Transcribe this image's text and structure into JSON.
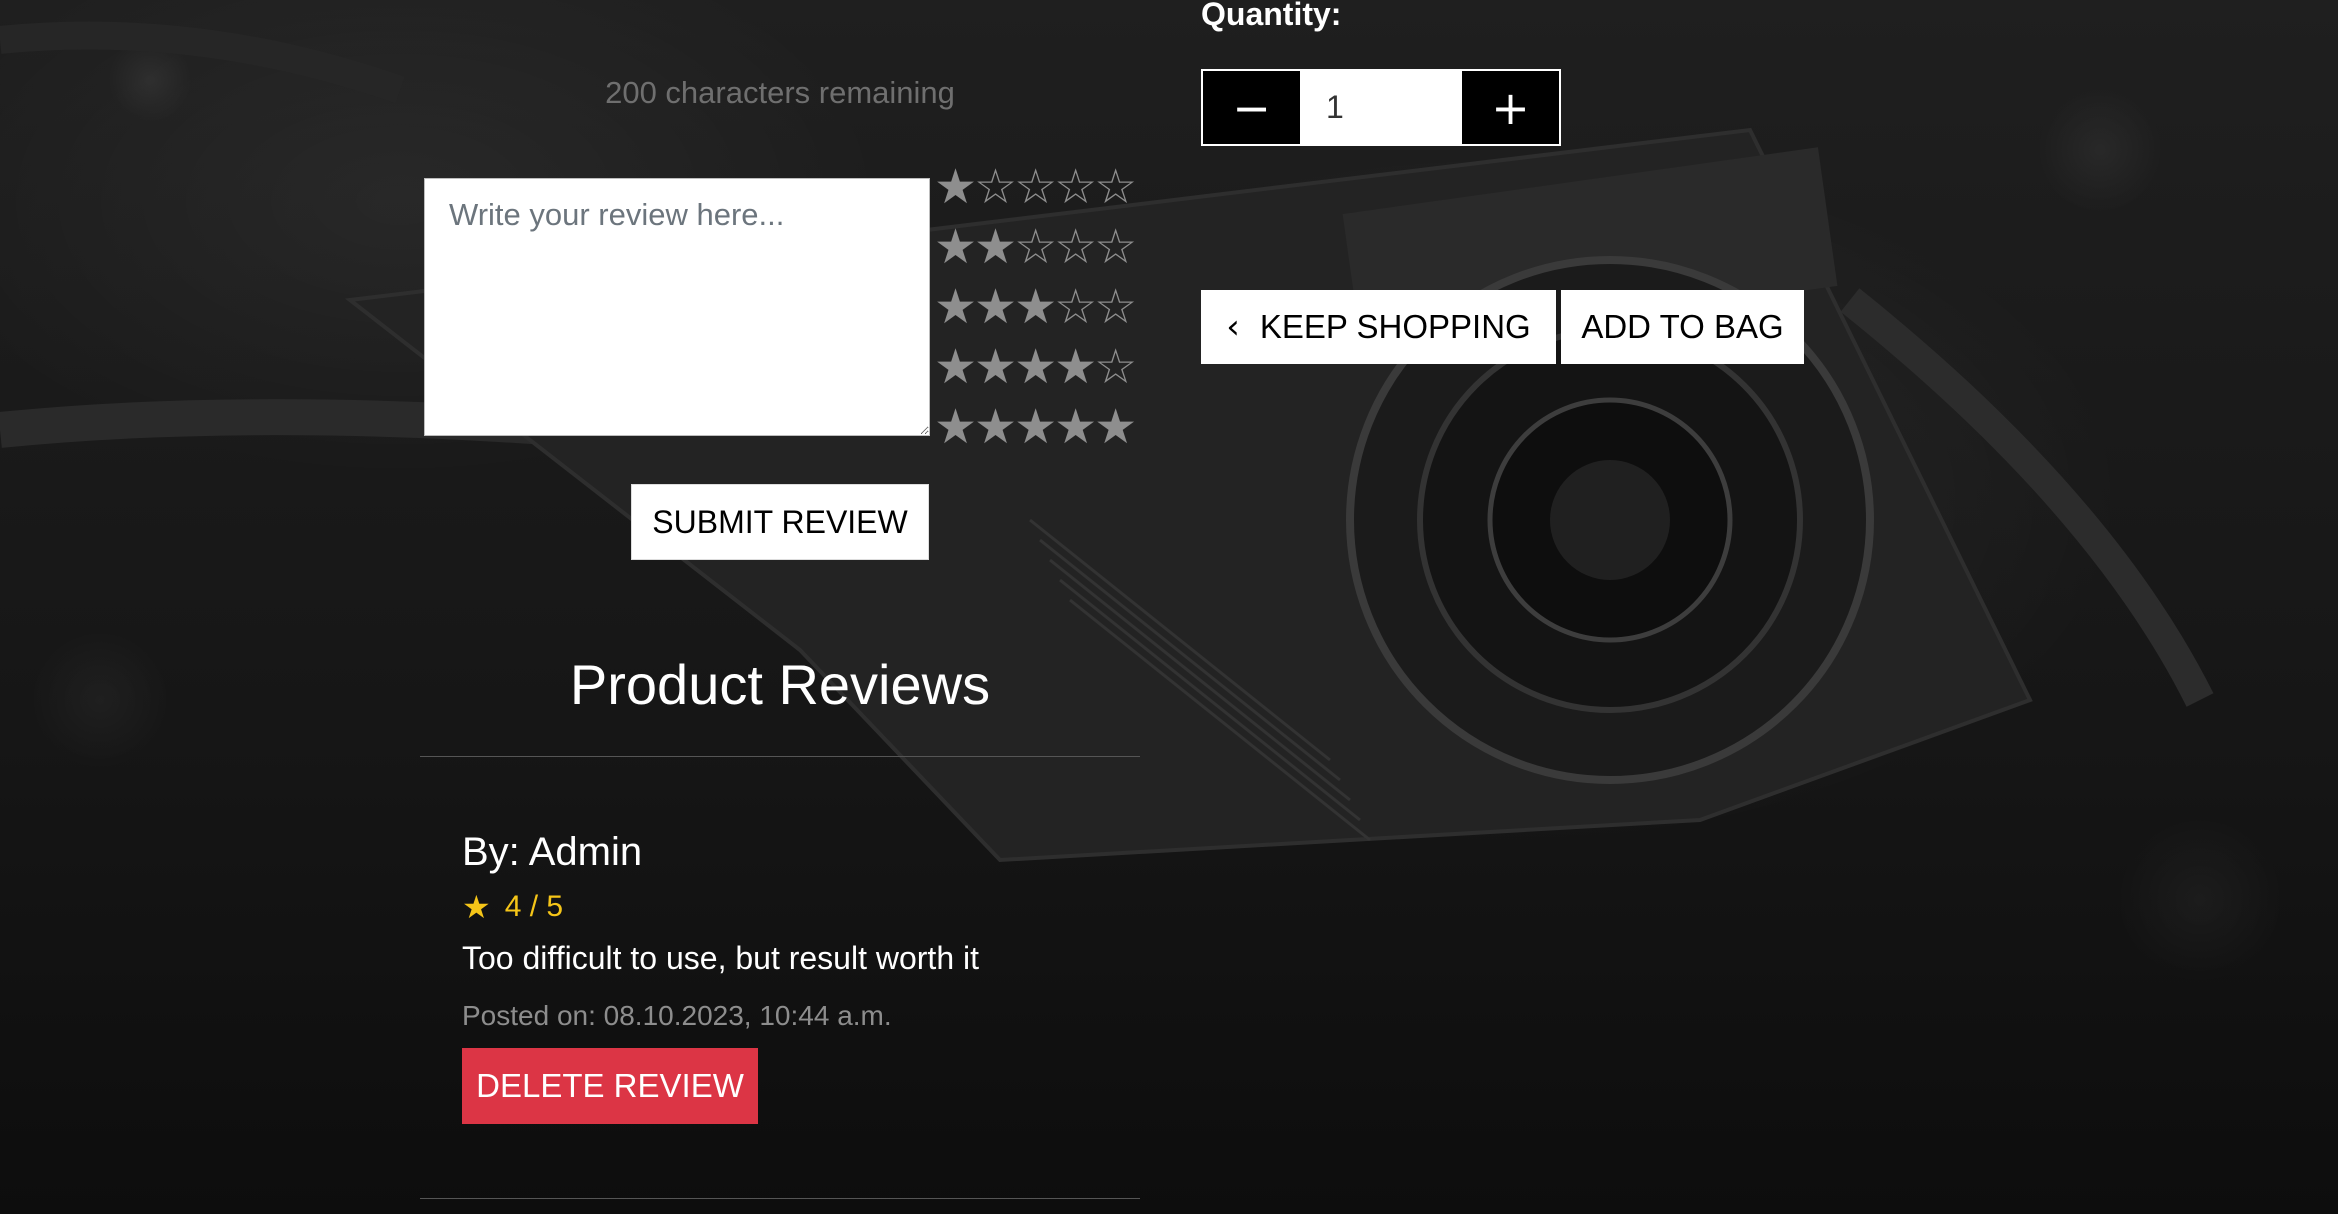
{
  "review_form": {
    "chars_remaining": "200 characters remaining",
    "textarea_placeholder": "Write your review here...",
    "rating_options": [
      {
        "filled": "★",
        "empty": "☆☆☆☆"
      },
      {
        "filled": "★★",
        "empty": "☆☆☆"
      },
      {
        "filled": "★★★",
        "empty": "☆☆"
      },
      {
        "filled": "★★★★",
        "empty": "☆"
      },
      {
        "filled": "★★★★★",
        "empty": ""
      }
    ],
    "submit_label": "SUBMIT REVIEW"
  },
  "reviews": {
    "heading": "Product Reviews",
    "items": [
      {
        "author": "By: Admin",
        "rating": "4 / 5",
        "body": "Too difficult to use, but result worth it",
        "posted": "Posted on: 08.10.2023, 10:44 a.m.",
        "delete_label": "DELETE REVIEW"
      }
    ]
  },
  "purchase": {
    "quantity_label": "Quantity:",
    "quantity_value": "1",
    "decrement_symbol": "−",
    "increment_symbol": "+",
    "keep_shopping_label": "KEEP SHOPPING",
    "add_to_bag_label": "ADD TO BAG"
  },
  "colors": {
    "delete_button": "#dc3545",
    "rating_star": "#f5c518"
  },
  "icons": {
    "rating": "star-icon",
    "keep_shopping": "chevron-left-icon"
  }
}
